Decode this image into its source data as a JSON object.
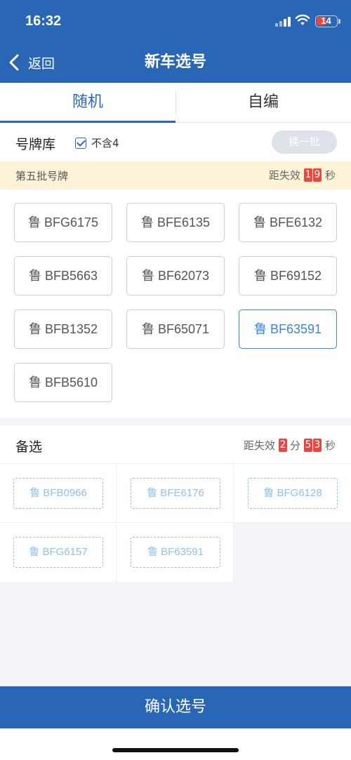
{
  "status_bar": {
    "time": "16:32",
    "battery": "14"
  },
  "header": {
    "back_label": "返回",
    "title": "新车选号"
  },
  "tabs": [
    {
      "label": "随机",
      "active": true
    },
    {
      "label": "自编",
      "active": false
    }
  ],
  "pool": {
    "title": "号牌库",
    "exclude_four_label": "不含4",
    "exclude_four_checked": true,
    "refresh_label": "换一批"
  },
  "batch": {
    "name": "第五批号牌",
    "countdown_prefix": "距失效",
    "digits": [
      "1",
      "9"
    ],
    "unit": "秒"
  },
  "plates": [
    {
      "text": "鲁 BFG6175",
      "selected": false
    },
    {
      "text": "鲁 BFE6135",
      "selected": false
    },
    {
      "text": "鲁 BFE6132",
      "selected": false
    },
    {
      "text": "鲁 BFB5663",
      "selected": false
    },
    {
      "text": "鲁 BF62073",
      "selected": false
    },
    {
      "text": "鲁 BF69152",
      "selected": false
    },
    {
      "text": "鲁 BFB1352",
      "selected": false
    },
    {
      "text": "鲁 BF65071",
      "selected": false
    },
    {
      "text": "鲁 BF63591",
      "selected": true
    },
    {
      "text": "鲁 BFB5610",
      "selected": false
    }
  ],
  "alternates": {
    "title": "备选",
    "countdown_prefix": "距失效",
    "minutes": [
      "2"
    ],
    "minute_unit": "分",
    "seconds": [
      "5",
      "3"
    ],
    "second_unit": "秒",
    "items": [
      "鲁 BFB0966",
      "鲁 BFE6176",
      "鲁 BFG6128",
      "鲁 BFG6157",
      "鲁 BF63591"
    ]
  },
  "confirm_label": "确认选号",
  "colors": {
    "primary": "#2a66b6",
    "accent_red": "#e8463f",
    "selected_border": "#3b84d6",
    "batch_bg": "#fdf3d9"
  }
}
